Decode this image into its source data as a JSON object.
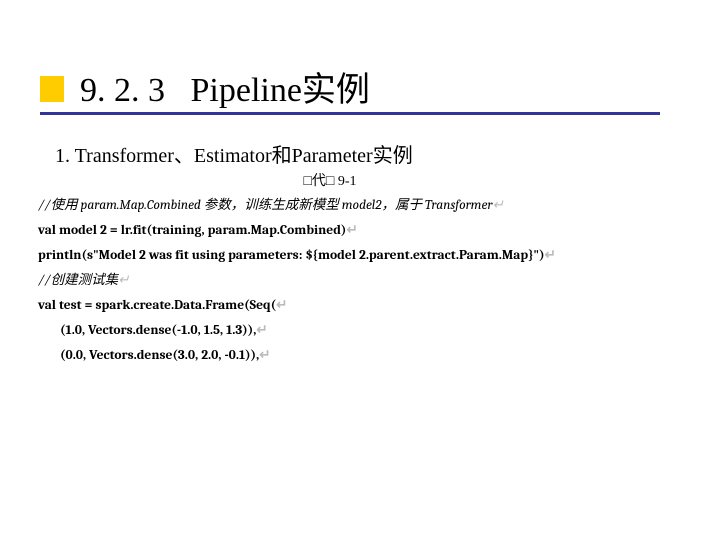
{
  "header": {
    "section_number": "9. 2. 3",
    "section_title": "Pipeline实例"
  },
  "subtitle": "1. Transformer、Estimator和Parameter实例",
  "code_label": "□代□ 9-1",
  "code": {
    "line1_comment": "//使用 param.Map.Combined 参数，训练生成新模型 model2，属于 Transformer",
    "line2": "val model 2 = lr.fit(training, param.Map.Combined)",
    "line3": "println(s\"Model 2 was fit using parameters: ${model 2.parent.extract.Param.Map}\")",
    "line4_comment": "//创建测试集",
    "line5": "val test = spark.create.Data.Frame(Seq(",
    "line6": "(1.0, Vectors.dense(-1.0, 1.5, 1.3)),",
    "line7": "(0.0, Vectors.dense(3.0, 2.0, -0.1)),"
  }
}
